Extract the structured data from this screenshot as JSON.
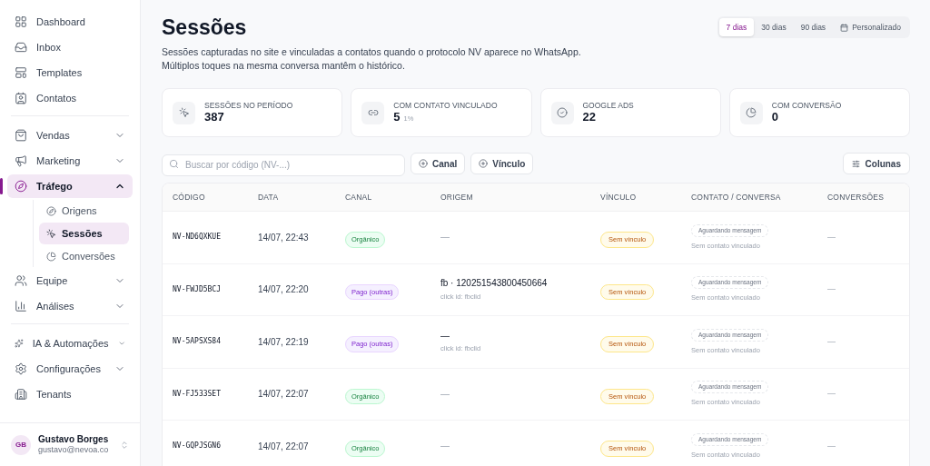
{
  "sidebar": {
    "sections": [
      {
        "items": [
          {
            "label": "Dashboard",
            "selected": false
          },
          {
            "label": "Inbox",
            "selected": false
          },
          {
            "label": "Templates",
            "selected": false
          },
          {
            "label": "Contatos",
            "selected": false
          }
        ]
      },
      {
        "items": [
          {
            "label": "Vendas",
            "expanded": false,
            "selected": false
          },
          {
            "label": "Marketing",
            "expanded": false,
            "selected": false
          },
          {
            "label": "Tráfego",
            "expanded": true,
            "selected": true,
            "children": [
              {
                "label": "Origens",
                "selected": false
              },
              {
                "label": "Sessões",
                "selected": true
              },
              {
                "label": "Conversões",
                "selected": false
              }
            ]
          },
          {
            "label": "Equipe",
            "expanded": false,
            "selected": false
          },
          {
            "label": "Análises",
            "expanded": false,
            "selected": false
          }
        ]
      },
      {
        "items": [
          {
            "label": "IA & Automações",
            "expanded": false,
            "selected": false
          },
          {
            "label": "Configurações",
            "expanded": false,
            "selected": false
          },
          {
            "label": "Tenants",
            "selected": false
          }
        ]
      }
    ],
    "user": {
      "initials": "GB",
      "name": "Gustavo Borges",
      "email": "gustavo@nevoa.co"
    }
  },
  "page": {
    "title": "Sessões",
    "description": [
      "Sessões capturadas no site e vinculadas a contatos quando o protocolo NV aparece no WhatsApp.",
      "Múltiplos toques na mesma conversa mantêm o histórico."
    ]
  },
  "period_tabs": [
    {
      "label": "7 dias",
      "selected": true,
      "kind": "text"
    },
    {
      "label": "30 dias",
      "selected": false,
      "kind": "text"
    },
    {
      "label": "90 dias",
      "selected": false,
      "kind": "text"
    },
    {
      "label": "Personalizado",
      "selected": false,
      "kind": "calendar"
    }
  ],
  "stats": [
    {
      "label": "SESSÕES NO PERÍODO",
      "value": "387"
    },
    {
      "label": "COM CONTATO VINCULADO",
      "value": "5",
      "sub": "1%"
    },
    {
      "label": "GOOGLE ADS",
      "value": "22"
    },
    {
      "label": "COM CONVERSÃO",
      "value": "0"
    }
  ],
  "toolbar": {
    "search": {
      "placeholder": "Buscar por código (NV-...)"
    },
    "filters": [
      "Canal",
      "Vínculo"
    ],
    "columns_button": "Colunas"
  },
  "table": {
    "columns": [
      "CÓDIGO",
      "DATA",
      "CANAL",
      "ORIGEM",
      "VÍNCULO",
      "CONTATO / CONVERSA",
      "CONVERSÕES"
    ],
    "rows": [
      {
        "code": "NV-ND6QXKUE",
        "date": "14/07, 22:43",
        "channel": {
          "label": "Orgânico",
          "kind": "organic"
        },
        "origin": "—",
        "vinculo": "Sem vínculo",
        "status": "Aguardando mensagem",
        "contact": "Sem contato vinculado",
        "conversions": "—"
      },
      {
        "code": "NV-FWJD5BCJ",
        "date": "14/07, 22:20",
        "channel": {
          "label": "Pago (outras)",
          "kind": "paid"
        },
        "origin": "fb · 120251543800450664",
        "click_id": "click id: fbclid",
        "vinculo": "Sem vínculo",
        "status": "Aguardando mensagem",
        "contact": "Sem contato vinculado",
        "conversions": "—"
      },
      {
        "code": "NV-5APSXS84",
        "date": "14/07, 22:19",
        "channel": {
          "label": "Pago (outras)",
          "kind": "paid"
        },
        "origin": "—",
        "click_id": "click id: fbclid",
        "vinculo": "Sem vínculo",
        "status": "Aguardando mensagem",
        "contact": "Sem contato vinculado",
        "conversions": "—"
      },
      {
        "code": "NV-FJ533SET",
        "date": "14/07, 22:07",
        "channel": {
          "label": "Orgânico",
          "kind": "organic"
        },
        "origin": "—",
        "vinculo": "Sem vínculo",
        "status": "Aguardando mensagem",
        "contact": "Sem contato vinculado",
        "conversions": "—"
      },
      {
        "code": "NV-GQPJSGN6",
        "date": "14/07, 22:07",
        "channel": {
          "label": "Orgânico",
          "kind": "organic"
        },
        "origin": "—",
        "vinculo": "Sem vínculo",
        "status": "Aguardando mensagem",
        "contact": "Sem contato vinculado",
        "conversions": "—"
      }
    ]
  }
}
